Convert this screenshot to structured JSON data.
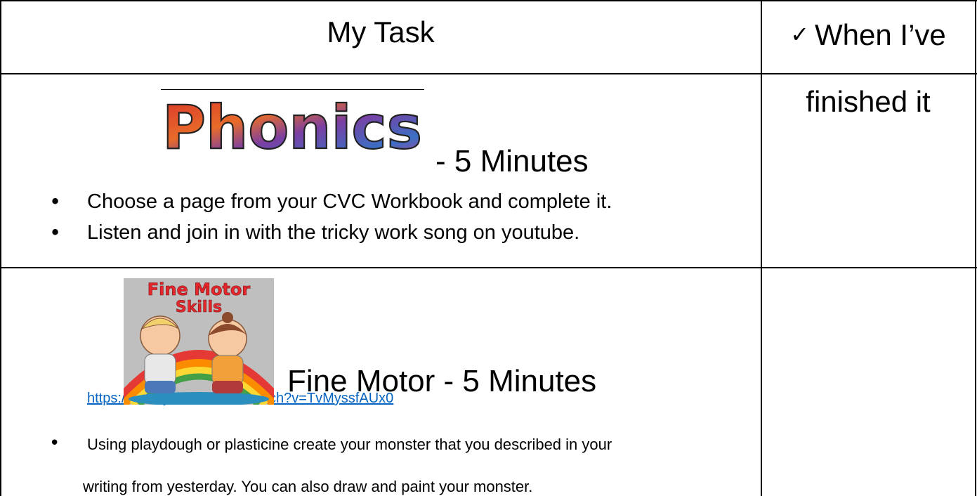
{
  "header": {
    "task_label": "My Task",
    "done_tick": "✓",
    "done_line1": "When I’ve",
    "done_line2": "finished it"
  },
  "phonics": {
    "logo_text": "Phonics",
    "duration": "- 5 Minutes",
    "items": [
      "Choose a page from your CVC Workbook and complete it.",
      "Listen and join in with the tricky work song on youtube."
    ],
    "link": "https://www.youtube.com/watch?v=TvMyssfAUx0"
  },
  "fine_motor": {
    "image_line1": "Fine Motor",
    "image_line2": "Skills",
    "title": "Fine Motor - 5 Minutes",
    "item_line1": "Using playdough or plasticine create your monster that you described in your",
    "item_line2": "writing from yesterday. You can also draw and paint your monster."
  },
  "colors": {
    "link": "#0563c1",
    "grid": "#000000",
    "image_title": "#e5262c"
  }
}
